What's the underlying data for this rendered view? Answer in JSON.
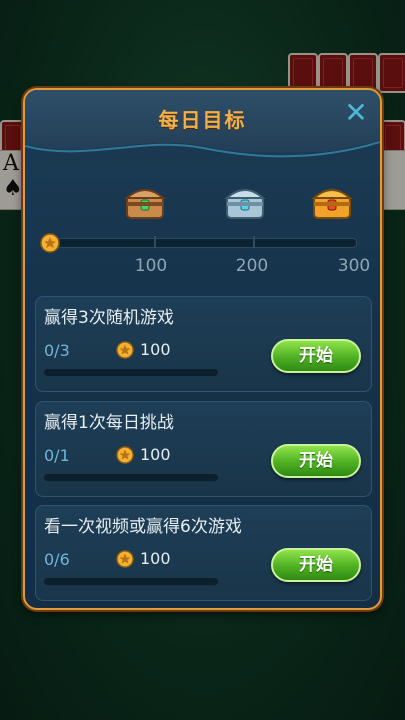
{
  "dialog": {
    "title": "每日目标",
    "milestones": [
      {
        "label": "100",
        "chest": "green-chest"
      },
      {
        "label": "200",
        "chest": "blue-chest"
      },
      {
        "label": "300",
        "chest": "gold-chest"
      }
    ],
    "progress_fraction": 0.0
  },
  "tasks": [
    {
      "title": "赢得3次随机游戏",
      "progress": "0/3",
      "reward": "100",
      "button": "开始",
      "fill": 0.0
    },
    {
      "title": "赢得1次每日挑战",
      "progress": "0/1",
      "reward": "100",
      "button": "开始",
      "fill": 0.0
    },
    {
      "title": "看一次视频或赢得6次游戏",
      "progress": "0/6",
      "reward": "100",
      "button": "开始",
      "fill": 0.0
    }
  ],
  "colors": {
    "accent": "#f3b04a",
    "panel": "#1d3d56",
    "button": "#4fb022",
    "close": "#4fb7d8"
  },
  "icons": {
    "close": "close-icon",
    "coin": "coin-icon"
  }
}
